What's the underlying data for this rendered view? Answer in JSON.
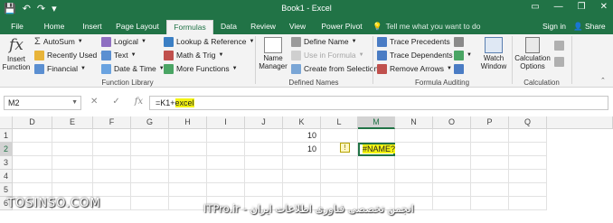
{
  "window": {
    "title": "Book1 - Excel",
    "controls": [
      "▭",
      "—",
      "❐",
      "✕"
    ]
  },
  "qat": {
    "save": "💾",
    "undo": "↶",
    "redo": "↷",
    "customize": "▾"
  },
  "tabs": [
    {
      "label": "File"
    },
    {
      "label": "Home"
    },
    {
      "label": "Insert"
    },
    {
      "label": "Page Layout"
    },
    {
      "label": "Formulas"
    },
    {
      "label": "Data"
    },
    {
      "label": "Review"
    },
    {
      "label": "View"
    },
    {
      "label": "Power Pivot"
    }
  ],
  "active_tab": "Formulas",
  "tell_me": "Tell me what you want to do",
  "sign_in": "Sign in",
  "share": "Share",
  "ribbon": {
    "function_library": {
      "label": "Function Library",
      "insert_function": [
        "Insert",
        "Function"
      ],
      "autosum": "AutoSum",
      "recently_used": "Recently Used",
      "financial": "Financial",
      "logical": "Logical",
      "text": "Text",
      "date_time": "Date & Time",
      "lookup": "Lookup & Reference",
      "math": "Math & Trig",
      "more": "More Functions"
    },
    "defined_names": {
      "label": "Defined Names",
      "name_manager": [
        "Name",
        "Manager"
      ],
      "define_name": "Define Name",
      "use_in_formula": "Use in Formula",
      "create_from_selection": "Create from Selection"
    },
    "formula_auditing": {
      "label": "Formula Auditing",
      "trace_precedents": "Trace Precedents",
      "trace_dependents": "Trace Dependents",
      "remove_arrows": "Remove Arrows",
      "watch_window": [
        "Watch",
        "Window"
      ]
    },
    "calculation": {
      "label": "Calculation",
      "calculation_options": [
        "Calculation",
        "Options"
      ]
    }
  },
  "formula_bar": {
    "name_box": "M2",
    "cancel": "✕",
    "enter": "✓",
    "fx": "fx",
    "formula_prefix": "=K1+",
    "formula_highlight": "excel"
  },
  "grid": {
    "columns": [
      "D",
      "E",
      "F",
      "G",
      "H",
      "I",
      "J",
      "K",
      "L",
      "M",
      "N",
      "O",
      "P",
      "Q"
    ],
    "rows": [
      "1",
      "2",
      "3",
      "4",
      "5",
      "6"
    ],
    "selected_column": "M",
    "selected_row": "2",
    "cells": {
      "K1": "10",
      "K2": "10",
      "M2": "#NAME?"
    },
    "error_indicator": "!"
  },
  "watermark": {
    "left": "TOSINSO.COM",
    "right": "ITPro.ir - انجمن تخصصی فناوری اطلاعات ایران"
  },
  "colors": {
    "accent": "#217346",
    "highlight": "#f4f411"
  }
}
